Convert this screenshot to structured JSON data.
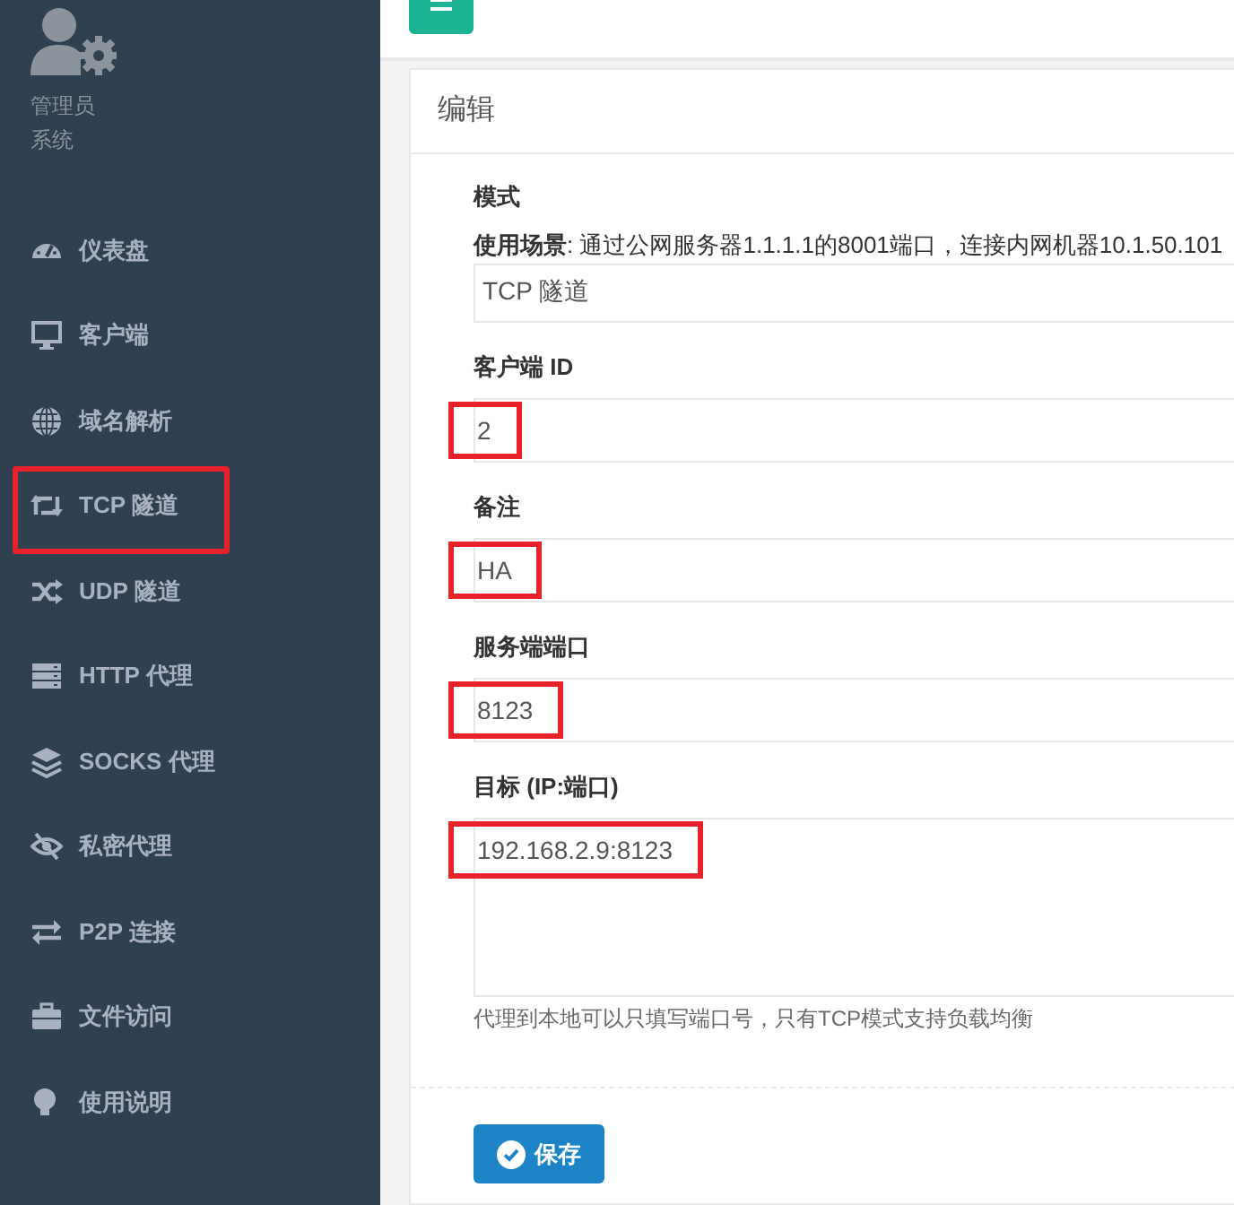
{
  "sidebar": {
    "profile": {
      "name": "管理员",
      "role": "系统"
    },
    "items": [
      {
        "label": "仪表盘",
        "highlighted": false
      },
      {
        "label": "客户端",
        "highlighted": false
      },
      {
        "label": "域名解析",
        "highlighted": false
      },
      {
        "label": "TCP 隧道",
        "highlighted": true
      },
      {
        "label": "UDP 隧道",
        "highlighted": false
      },
      {
        "label": "HTTP 代理",
        "highlighted": false
      },
      {
        "label": "SOCKS 代理",
        "highlighted": false
      },
      {
        "label": "私密代理",
        "highlighted": false
      },
      {
        "label": "P2P 连接",
        "highlighted": false
      },
      {
        "label": "文件访问",
        "highlighted": false
      },
      {
        "label": "使用说明",
        "highlighted": false
      }
    ]
  },
  "card": {
    "title": "编辑",
    "fields": [
      {
        "kind": "select",
        "label": "模式",
        "description": "**使用场景**: 通过公网服务器1.1.1.1的8001端口，连接内网机器10.1.50.101",
        "value": "TCP 隧道",
        "highlighted": false
      },
      {
        "kind": "input",
        "label": "客户端 ID",
        "value": "2",
        "highlighted": true
      },
      {
        "kind": "input",
        "label": "备注",
        "value": "HA",
        "highlighted": true
      },
      {
        "kind": "input",
        "label": "服务端端口",
        "value": "8123",
        "highlighted": true
      },
      {
        "kind": "textarea",
        "label": "目标 (IP:端口)",
        "value": "192.168.2.9:8123",
        "highlighted": true,
        "help": "代理到本地可以只填写端口号，只有TCP模式支持负载均衡"
      }
    ],
    "save_button": "保存"
  }
}
